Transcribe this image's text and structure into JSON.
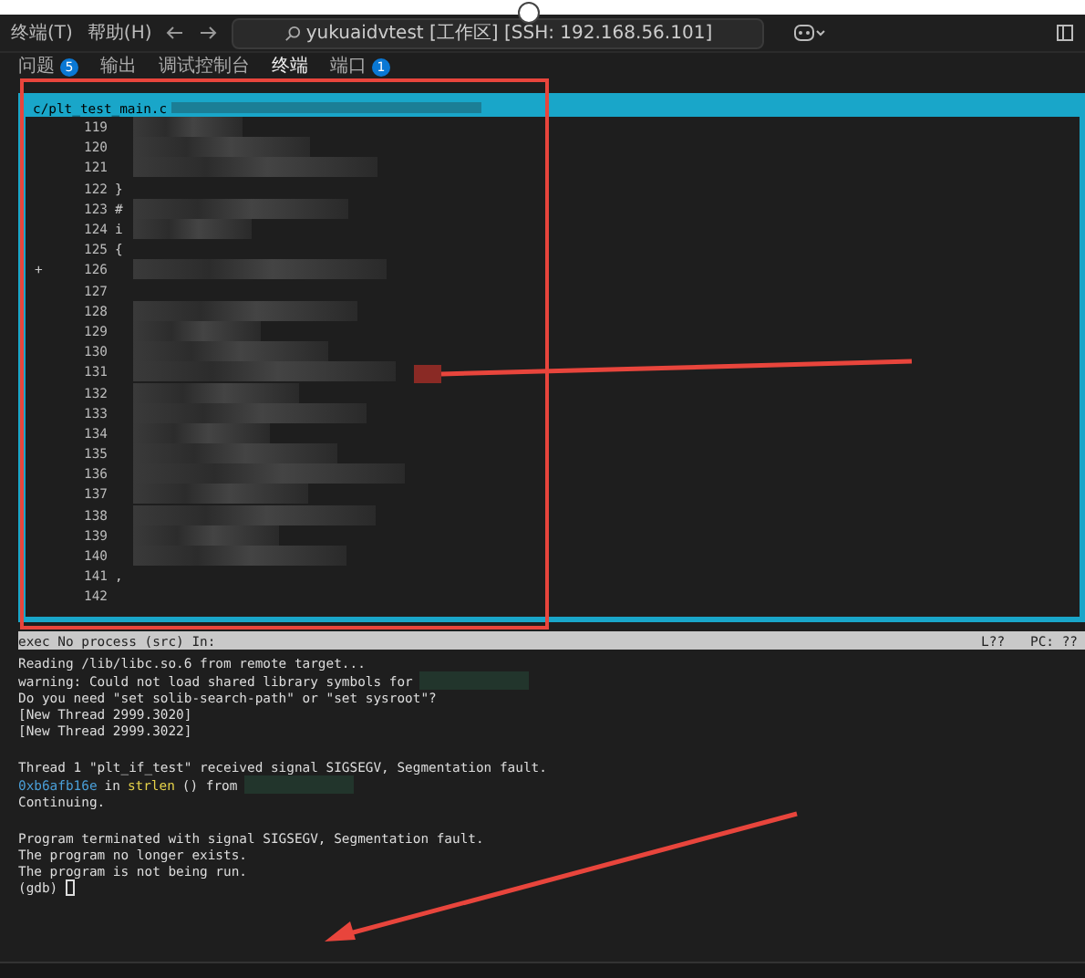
{
  "menu": [
    "终端(T)",
    "帮助(H)"
  ],
  "title": "yukuaidvtest [工作区] [SSH: 192.168.56.101]",
  "panel_tabs": [
    {
      "label": "问题",
      "badge": "5",
      "selected": false
    },
    {
      "label": "输出",
      "selected": false
    },
    {
      "label": "调试控制台",
      "selected": false
    },
    {
      "label": "终端",
      "selected": true
    },
    {
      "label": "端口",
      "badge": "1",
      "selected": false
    }
  ],
  "source": {
    "file": "c/plt_test_main.c",
    "lines": [
      {
        "number": "119",
        "redacted": true
      },
      {
        "number": "120",
        "redacted": true
      },
      {
        "number": "121",
        "redacted": true
      },
      {
        "number": "122",
        "text": "}",
        "redacted": false
      },
      {
        "number": "123",
        "text": "#",
        "redacted": true
      },
      {
        "number": "124",
        "text": "i",
        "redacted": true
      },
      {
        "number": "125",
        "text": "{",
        "redacted": false
      },
      {
        "number": "126",
        "marker": "+",
        "redacted": true
      },
      {
        "number": "127",
        "redacted": false
      },
      {
        "number": "128",
        "redacted": true
      },
      {
        "number": "129",
        "redacted": true
      },
      {
        "number": "130",
        "redacted": true
      },
      {
        "number": "131",
        "redacted": true
      },
      {
        "number": "132",
        "redacted": true
      },
      {
        "number": "133",
        "redacted": true
      },
      {
        "number": "134",
        "redacted": true
      },
      {
        "number": "135",
        "redacted": true
      },
      {
        "number": "136",
        "redacted": true
      },
      {
        "number": "137",
        "redacted": true
      },
      {
        "number": "138",
        "redacted": true
      },
      {
        "number": "139",
        "redacted": true
      },
      {
        "number": "140",
        "redacted": true
      },
      {
        "number": "141",
        "text": ",",
        "redacted": false
      },
      {
        "number": "142",
        "redacted": false
      }
    ]
  },
  "tui_status": {
    "left": "exec No process (src) In:",
    "line": "L??",
    "pc": "PC: ??"
  },
  "console": [
    {
      "segments": [
        {
          "kind": "plain",
          "text": "Reading /lib/libc.so.6 from remote target..."
        }
      ]
    },
    {
      "segments": [
        {
          "kind": "plain",
          "text": "warning: Could not load shared library symbols for"
        }
      ],
      "redacted": true
    },
    {
      "segments": [
        {
          "kind": "plain",
          "text": "Do you need \"set solib-search-path\" or \"set sysroot\"?"
        }
      ]
    },
    {
      "segments": [
        {
          "kind": "plain",
          "text": "[New Thread 2999.3020]"
        }
      ]
    },
    {
      "segments": [
        {
          "kind": "plain",
          "text": "[New Thread 2999.3022]"
        }
      ]
    },
    {
      "blank": true
    },
    {
      "segments": [
        {
          "kind": "plain",
          "text": "Thread 1 \"plt_if_test\" received signal SIGSEGV, Segmentation fault."
        }
      ]
    },
    {
      "segments": [
        {
          "kind": "address",
          "text": "0xb6afb16e"
        },
        {
          "kind": "plain",
          "text": "in"
        },
        {
          "kind": "function",
          "text": "strlen"
        },
        {
          "kind": "plain",
          "text": "() from"
        }
      ],
      "redacted": true
    },
    {
      "segments": [
        {
          "kind": "plain",
          "text": "Continuing."
        }
      ]
    },
    {
      "blank": true
    },
    {
      "segments": [
        {
          "kind": "plain",
          "text": "Program terminated with signal SIGSEGV, Segmentation fault."
        }
      ]
    },
    {
      "segments": [
        {
          "kind": "plain",
          "text": "The program no longer exists."
        }
      ]
    },
    {
      "segments": [
        {
          "kind": "plain",
          "text": "The program is not being run."
        }
      ]
    },
    {
      "segments": [
        {
          "kind": "plain",
          "text": "(gdb)"
        }
      ],
      "cursor": true
    }
  ]
}
